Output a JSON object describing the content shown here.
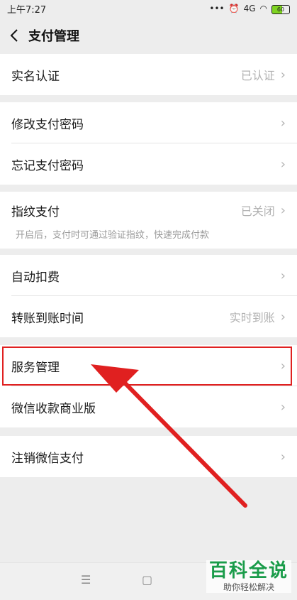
{
  "status_bar": {
    "time": "上午7:27",
    "battery": "60",
    "signal": "4G"
  },
  "nav": {
    "title": "支付管理"
  },
  "groups": [
    {
      "items": [
        {
          "label": "实名认证",
          "value": "已认证"
        }
      ]
    },
    {
      "items": [
        {
          "label": "修改支付密码",
          "value": ""
        },
        {
          "label": "忘记支付密码",
          "value": ""
        }
      ]
    },
    {
      "items": [
        {
          "label": "指纹支付",
          "value": "已关闭"
        }
      ],
      "hint": "开启后，支付时可通过验证指纹，快速完成付款"
    },
    {
      "items": [
        {
          "label": "自动扣费",
          "value": ""
        },
        {
          "label": "转账到账时间",
          "value": "实时到账"
        }
      ]
    },
    {
      "items": [
        {
          "label": "服务管理",
          "value": ""
        },
        {
          "label": "微信收款商业版",
          "value": ""
        }
      ]
    },
    {
      "items": [
        {
          "label": "注销微信支付",
          "value": ""
        }
      ]
    }
  ],
  "watermark": {
    "title": "百科全说",
    "subtitle": "助你轻松解决"
  },
  "colors": {
    "highlight": "#e02020",
    "watermark": "#1a9c4a"
  }
}
